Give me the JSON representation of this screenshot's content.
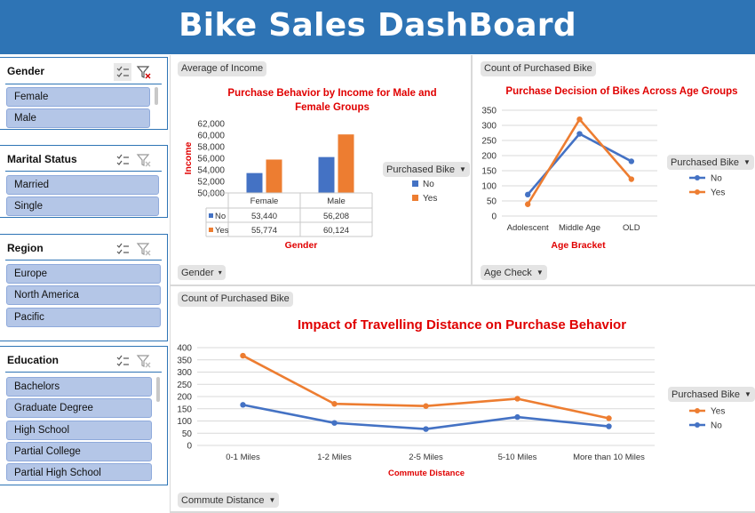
{
  "dashboard": {
    "title": "Bike Sales DashBoard"
  },
  "slicers": {
    "gender": {
      "title": "Gender",
      "items": [
        "Female",
        "Male"
      ]
    },
    "marital": {
      "title": "Marital Status",
      "items": [
        "Married",
        "Single"
      ]
    },
    "region": {
      "title": "Region",
      "items": [
        "Europe",
        "North America",
        "Pacific"
      ]
    },
    "education": {
      "title": "Education",
      "items": [
        "Bachelors",
        "Graduate Degree",
        "High School",
        "Partial College",
        "Partial High School"
      ]
    }
  },
  "pivot_buttons": {
    "income_value": "Average of Income",
    "income_axis": "Gender",
    "income_legend": "Purchased Bike",
    "age_value": "Count of Purchased Bike",
    "age_axis": "Age Check",
    "age_legend": "Purchased Bike",
    "commute_value": "Count of Purchased Bike",
    "commute_axis": "Commute Distance",
    "commute_legend": "Purchased Bike"
  },
  "colors": {
    "no": "#4472c4",
    "yes": "#ed7d31",
    "title_red": "#e00000",
    "header_blue": "#2e74b5"
  },
  "chart_data": [
    {
      "type": "bar",
      "title": "Purchase Behavior by Income for Male and Female Groups",
      "xlabel": "Gender",
      "ylabel": "Income",
      "categories": [
        "Female",
        "Male"
      ],
      "series": [
        {
          "name": "No",
          "values": [
            53440,
            56208
          ],
          "labels": [
            "53,440",
            "56,208"
          ]
        },
        {
          "name": "Yes",
          "values": [
            55774,
            60124
          ],
          "labels": [
            "55,774",
            "60,124"
          ]
        }
      ],
      "ylim": [
        50000,
        62000
      ],
      "yticks": [
        "50,000",
        "52,000",
        "54,000",
        "56,000",
        "58,000",
        "60,000",
        "62,000"
      ],
      "legend_title": "Purchased Bike",
      "data_table": true
    },
    {
      "type": "line",
      "title": "Purchase Decision of Bikes Across Age Groups",
      "xlabel": "Age Bracket",
      "ylabel": "",
      "categories": [
        "Adolescent",
        "Middle Age",
        "OLD"
      ],
      "series": [
        {
          "name": "No",
          "values": [
            71,
            272,
            181
          ]
        },
        {
          "name": "Yes",
          "values": [
            39,
            320,
            122
          ]
        }
      ],
      "ylim": [
        0,
        350
      ],
      "yticks": [
        "0",
        "50",
        "100",
        "150",
        "200",
        "250",
        "300",
        "350"
      ],
      "legend_title": "Purchased Bike",
      "grid": true
    },
    {
      "type": "line",
      "title": "Impact of Travelling Distance on Purchase Behavior",
      "xlabel": "Commute Distance",
      "ylabel": "",
      "categories": [
        "0-1 Miles",
        "1-2 Miles",
        "2-5 Miles",
        "5-10 Miles",
        "More than 10 Miles"
      ],
      "series": [
        {
          "name": "Yes",
          "values": [
            367,
            170,
            161,
            191,
            111
          ]
        },
        {
          "name": "No",
          "values": [
            166,
            92,
            67,
            116,
            78
          ]
        }
      ],
      "ylim": [
        0,
        400
      ],
      "yticks": [
        "0",
        "50",
        "100",
        "150",
        "200",
        "250",
        "300",
        "350",
        "400"
      ],
      "legend_title": "Purchased Bike",
      "grid": true
    }
  ]
}
